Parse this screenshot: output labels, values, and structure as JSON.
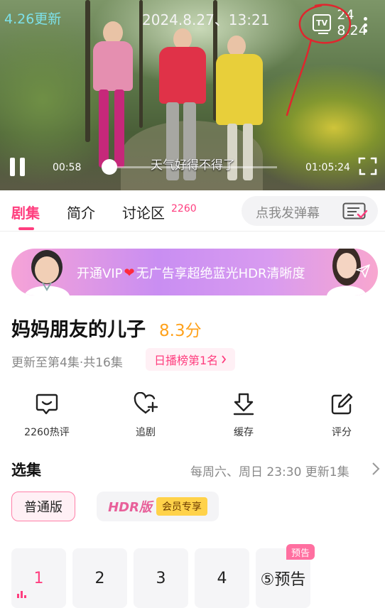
{
  "player": {
    "back_text": "4.26更新",
    "timestamp_text": "2024.8.27、13:21",
    "tv_label": "TV",
    "right_text": "24 8.24",
    "subtitle": "天气好得不得了",
    "current_time": "00:58",
    "duration": "01:05:24",
    "progress_fraction": 0.01
  },
  "tabs": {
    "episodes": "剧集",
    "intro": "简介",
    "discussion": "讨论区",
    "discussion_count": "2260",
    "danmu_placeholder": "点我发弹幕"
  },
  "vip_banner": {
    "text_before": "开通VIP",
    "text_after": "无广告享超绝蓝光HDR清晰度"
  },
  "show": {
    "title": "妈妈朋友的儿子",
    "score": "8.3分",
    "update_info": "更新至第4集·共16集",
    "rank": "日播榜第1名"
  },
  "actions": [
    {
      "label": "2260热评",
      "icon": "comment-icon"
    },
    {
      "label": "追剧",
      "icon": "heart-plus-icon"
    },
    {
      "label": "缓存",
      "icon": "download-icon"
    },
    {
      "label": "评分",
      "icon": "edit-icon"
    }
  ],
  "episodes_section": {
    "title": "选集",
    "schedule": "每周六、周日 23:30 更新1集",
    "version_normal": "普通版",
    "version_hdr": "HDR版",
    "vip_only": "会员专享",
    "items": [
      "1",
      "2",
      "3",
      "4",
      "⑤预告"
    ],
    "active_index": 0,
    "preview_tag": "预告"
  },
  "colors": {
    "accent": "#ff3e7f",
    "score": "#ffa21c",
    "annotation": "#e0262e"
  }
}
